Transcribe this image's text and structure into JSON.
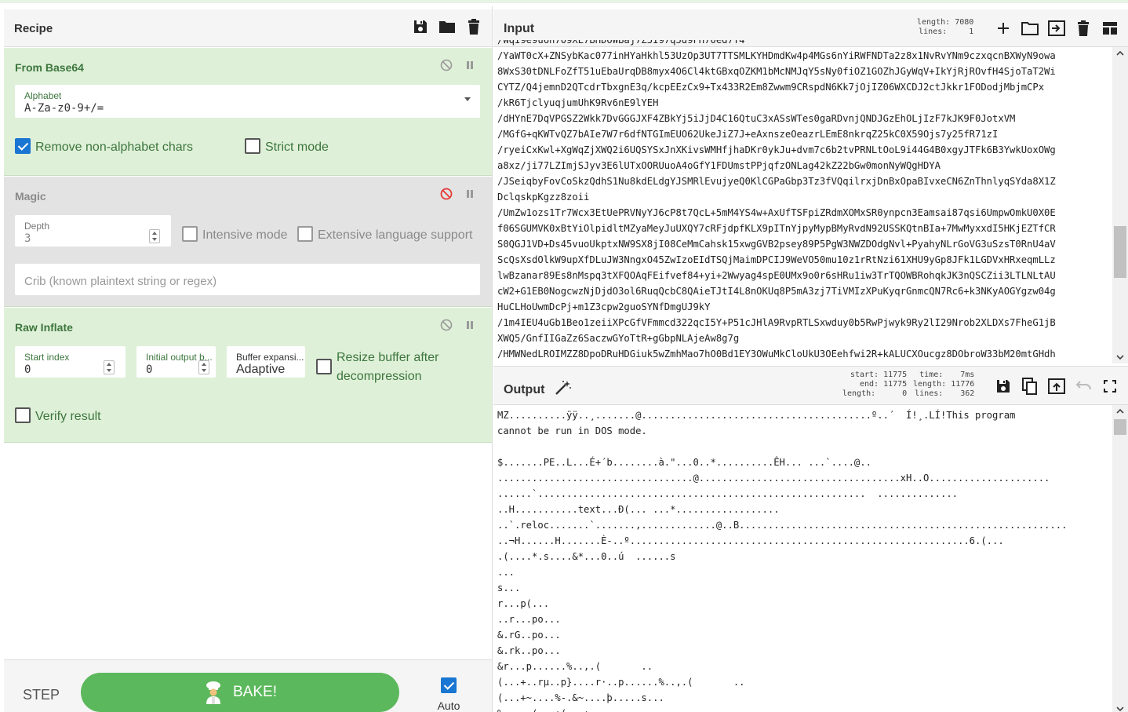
{
  "recipe": {
    "title": "Recipe",
    "operations": {
      "from_base64": {
        "title": "From Base64",
        "alphabet_label": "Alphabet",
        "alphabet_value": "A-Za-z0-9+/=",
        "remove_non_alpha_label": "Remove non-alphabet chars",
        "strict_mode_label": "Strict mode"
      },
      "magic": {
        "title": "Magic",
        "depth_label": "Depth",
        "depth_value": "3",
        "intensive_label": "Intensive mode",
        "extensive_label": "Extensive language support",
        "crib_placeholder": "Crib (known plaintext string or regex)"
      },
      "raw_inflate": {
        "title": "Raw Inflate",
        "start_index_label": "Start index",
        "start_index_value": "0",
        "initial_output_label": "Initial output b...",
        "initial_output_value": "0",
        "buffer_expansion_label": "Buffer expansi...",
        "buffer_expansion_value": "Adaptive",
        "resize_label_1": "Resize buffer after",
        "resize_label_2": "decompression",
        "verify_label": "Verify result"
      }
    },
    "controls": {
      "step_label": "STEP",
      "bake_label": "BAKE!",
      "auto_bake_label": "Auto Bake"
    }
  },
  "input": {
    "title": "Input",
    "length_label": "length:",
    "length_value": "7080",
    "lines_label": "lines:",
    "lines_value": "1",
    "lines": [
      "/WqI9e9u6h709XE7BHDOWBaj7Z5I97q5d9FH70ed7Y4",
      "/YaWT0cX+ZNSybKac077inHYaHkhl53UzOp3UT7TTSMLKYHDmdKw4p4MGs6nYiRWFNDTa2z8x1NvRvYNm9czxqcnBXWyN9owa",
      "8WxS30tDNLFoZfT51uEbaUrqDB8myx4O6Cl4ktGBxqOZKM1bMcNMJqY5sNy0fiOZ1GOZhJGyWqV+IkYjRjROvfH4SjoTaT2Wi",
      "CYTZ/Q4jemnD2QTcdrTbxgnE3q/kcpEEzCx9+Tx433R2Em8Zwwm9CRspdN6Kk7jOjIZ06WXCDJ2ctJkkr1FODodjMbjmCPx",
      "/kR6TjclyuqjumUhK9Rv6nE9lYEH",
      "/dHYnE7DqVPGSZ2Wkk7DvGGGJXF4ZBkYj5iJjD4C16QtuC3xASsWTes0gaRDvnjQNDJGzEhOLjIzF7kJK9F0JotxVM",
      "/MGfG+qKWTvQZ7bAIe7W7r6dfNTGImEUO62UkeJiZ7J+eAxnszeOeazrLEmE8nkrqZ25kC0X59Ojs7y25fR71zI",
      "/ryeiCxKwl+XgWqZjXWQ2i6UQSYSxJnXKivsWMHfjhaDKr0ykJu+dvm7c6b2tvPRNLtOoL9i44G4B0xgyJTFk6B3YwkUoxOWg",
      "a8xz/ji77LZImjSJyv3E6lUTxOORUuoA4oGfY1FDUmstPPjqfzONLag42kZ22bGw0monNyWQgHDYA",
      "/JSeiqbyFovCoSkzQdhS1Nu8kdELdgYJSMRlEvujyeQ0KlCGPaGbp3Tz3fVQqilrxjDnBxOpaBIvxeCN6ZnThnlyqSYda8X1Z",
      "DclqskpKgzz8zoii",
      "/UmZw1ozs1Tr7Wcx3EtUePRVNyYJ6cP8t7QcL+5mM4YS4w+AxUfTSFpiZRdmXOMxSR0ynpcn3Eamsai87qsi6UmpwOmkU0X0E",
      "f06SGUMVK0xBtYiOlpidltMZyaMeyJuUXQY7cRFjdpfKLX9pITnYjpyMypBMyRvdN92USSKQtnBIa+7MwMyxxdI5HKjEZTfCR",
      "S0QGJ1VD+Ds45vuoUkptxNW9SX8jI08CeMmCahsk15xwgGVB2psey89P5PgW3NWZDOdgNvl+PyahyNLrGoVG3uSzsT0RnU4aV",
      "ScQsXsdOlkW9upXfDLuJW3NngxO45ZwIzoEIdTSQjMaimDPCIJ9WeVO50mu10z1rRtNzi61XHU9yGp8JFk1LGDVxHRxeqmLLz",
      "lwBzanar89Es8nMspq3tXFQOAqFEifvef84+yi+2Wwyag4spE0UMx9o0r6sHRu1iw3TrTQOWBRohqkJK3nQSCZii3LTLNLtAU",
      "cW2+G1EB0NogcwzNjDjdO3ol6RuqQcbC8QAieTJtI4L8nOKUq8P5mA3zj7TiVMIzXPuKyqrGnmcQN7Rc6+k3NKyAOGYgzw04g",
      "HuCLHoUwmDcPj+m1Z3cpw2guoSYNfDmgUJ9kY",
      "/1m4IEU4uGb1Beo1zeiiXPcGfVFmmcd322qcI5Y+P51cJHlA9RvpRTLSxwduy0b5RwPjwyk9Ry2lI29Nrob2XLDXs7FheG1jB",
      "XWQ5/GnfIIGaZz6SaczwGYoTtR+gGbpNLAjeAw8g7g",
      "/HMWNedLROIMZZ8DpoDRuHDGiuk5wZmhMao7hO0Bd1EY3OWuMkCloUkU3OEehfwi2R+kALUCXOucgz8DObroW33bM20mtGHdh"
    ]
  },
  "output": {
    "title": "Output",
    "start_label": "start:",
    "start_value": "11775",
    "end_label": "end:",
    "end_value": "11775",
    "sel_length_label": "length:",
    "sel_length_value": "0",
    "time_label": "time:",
    "time_value": "7ms",
    "length_label": "length:",
    "length_value": "11776",
    "lines_label": "lines:",
    "lines_value": "362",
    "lines": [
      "MZ..........ÿÿ..¸.......@........................................º..´  Í!¸.LÍ!This program",
      "cannot be run in DOS mode.",
      "",
      "$.......PE..L...É+´b........à.\"...0..*..........ÊH... ...`....@..",
      "..................................@...................................xH..O.....................",
      "......`.........................................................  ..............",
      "..H...........text...Ð(... ...*..................",
      "..`.reloc.......`.......,.............@..B.........................................................",
      "..¬H......H.......È-..º...........................................................6.(...",
      ".(....*.s....&*...0..ú  ......s",
      "...",
      "s...",
      "r...p(...",
      "..r...po...",
      "&.rG..po...",
      "&.rk..po...",
      "&r...p......%..,.(       ..",
      "(...+..rµ..p}....r·..p......%..,.(       ..",
      "(...+~....%-.&~....þ.....s...",
      "%.....(...+(...+"
    ]
  }
}
